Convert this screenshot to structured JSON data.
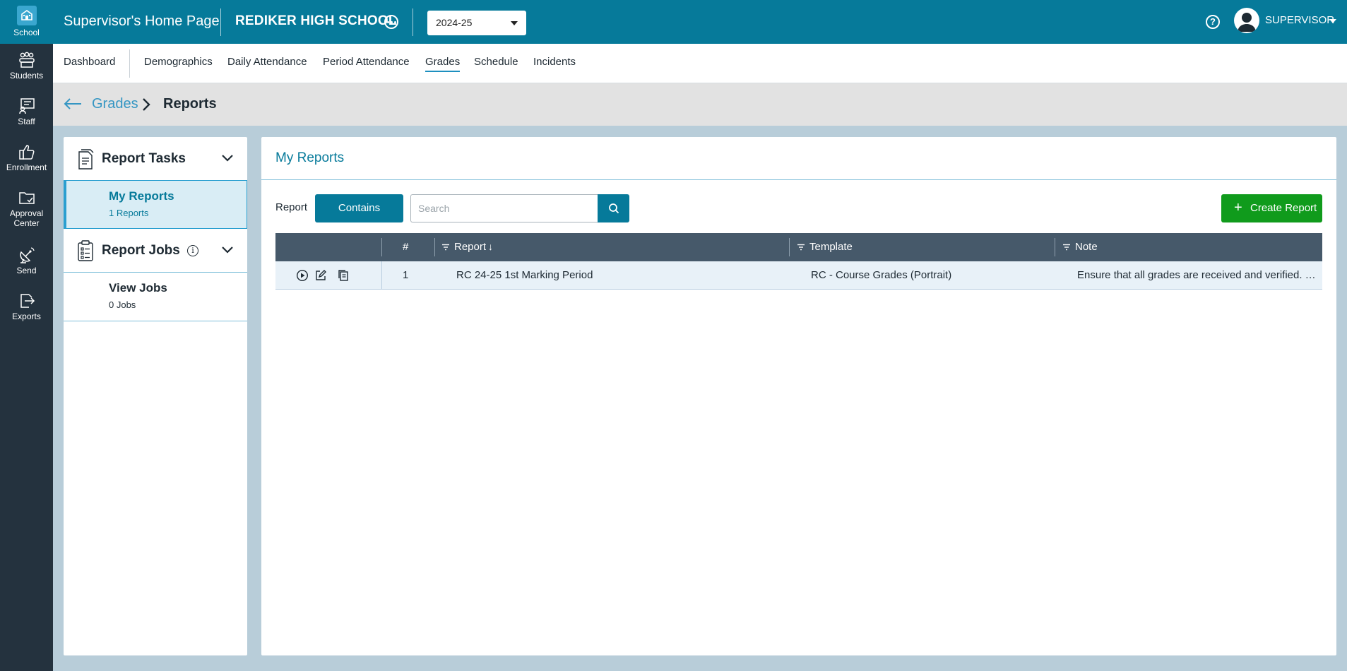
{
  "rail": {
    "items": [
      {
        "label": "School"
      },
      {
        "label": "Students"
      },
      {
        "label": "Staff"
      },
      {
        "label": "Enrollment"
      },
      {
        "label": "Approval Center"
      },
      {
        "label": "Send"
      },
      {
        "label": "Exports"
      }
    ]
  },
  "header": {
    "title": "Supervisor's Home Page",
    "school": "REDIKER HIGH SCHOOL",
    "year": "2024-25",
    "user": "SUPERVISOR",
    "help": "?"
  },
  "nav": {
    "tabs": [
      {
        "label": "Dashboard"
      },
      {
        "label": "Demographics"
      },
      {
        "label": "Daily Attendance"
      },
      {
        "label": "Period Attendance"
      },
      {
        "label": "Grades",
        "active": true
      },
      {
        "label": "Schedule"
      },
      {
        "label": "Incidents"
      }
    ]
  },
  "breadcrumb": {
    "parent": "Grades",
    "current": "Reports"
  },
  "left_panel": {
    "report_tasks": {
      "title": "Report Tasks",
      "item": {
        "label": "My Reports",
        "sub": "1 Reports"
      }
    },
    "report_jobs": {
      "title": "Report Jobs",
      "info": "i",
      "item": {
        "label": "View Jobs",
        "sub": "0 Jobs"
      }
    }
  },
  "main": {
    "title": "My Reports",
    "filter_label": "Report",
    "filter_mode": "Contains",
    "search_placeholder": "Search",
    "create_label": "Create Report",
    "table": {
      "headers": {
        "num": "#",
        "report": "Report",
        "report_sort": "↓",
        "template": "Template",
        "note": "Note"
      },
      "rows": [
        {
          "num": "1",
          "report": "RC 24-25 1st Marking Period",
          "template": "RC - Course Grades (Portrait)",
          "note": "Ensure that all grades are received and verified. …"
        }
      ]
    }
  },
  "colors": {
    "header": "#067a9a",
    "rail": "#24323e",
    "accent": "#3596c3",
    "create": "#109b1c",
    "table_header": "#46596a"
  }
}
